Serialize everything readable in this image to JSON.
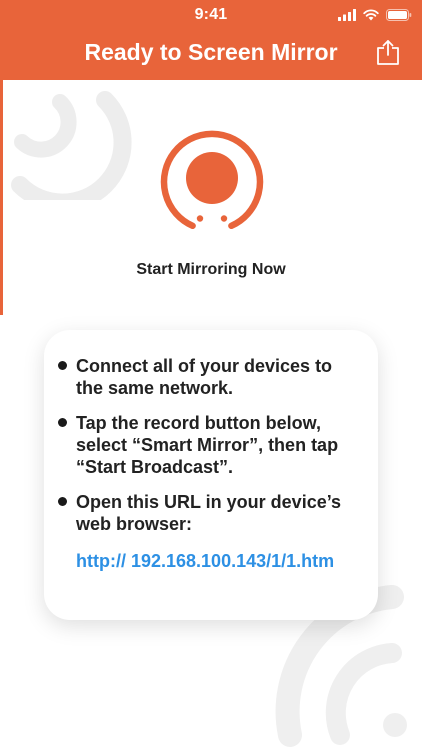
{
  "status_bar": {
    "time": "9:41",
    "icons": [
      "signal-icon",
      "wifi-icon",
      "battery-icon"
    ]
  },
  "header": {
    "title": "Ready to Screen Mirror",
    "share_icon": "share-icon",
    "background": "#E8643A"
  },
  "record": {
    "label": "Start Mirroring Now",
    "icon": "record-icon",
    "color": "#E8643A"
  },
  "instructions": {
    "steps": [
      {
        "text": "Connect all of your devices to the same network."
      },
      {
        "text": "Tap the record button below, select “Smart Mirror”, then tap “Start Broadcast”."
      },
      {
        "text": "Open this URL in your device’s web browser:",
        "link": "http:// 192.168.100.143/1/1.htm"
      }
    ],
    "link_color": "#2D90E4"
  }
}
